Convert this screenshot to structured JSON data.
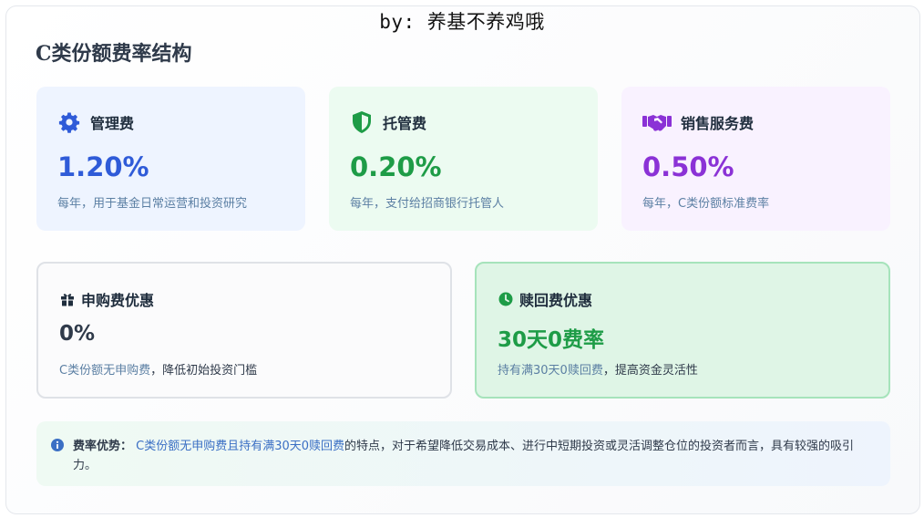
{
  "watermark": "by: 养基不养鸡哦",
  "page_title": "C类份额费率结构",
  "fee_cards": [
    {
      "icon": "gear-icon",
      "name": "管理费",
      "value": "1.20%",
      "desc": "每年，用于基金日常运营和投资研究",
      "color": "#2f5bd8"
    },
    {
      "icon": "shield-icon",
      "name": "托管费",
      "value": "0.20%",
      "desc": "每年，支付给招商银行托管人",
      "color": "#1e9c47"
    },
    {
      "icon": "handshake-icon",
      "name": "销售服务费",
      "value": "0.50%",
      "desc": "每年，C类份额标准费率",
      "color": "#8b32d6"
    }
  ],
  "discount_cards": [
    {
      "icon": "gift-icon",
      "name": "申购费优惠",
      "value": "0%",
      "desc_highlight": "C类份额无申购费",
      "desc_rest": "，降低初始投资门槛"
    },
    {
      "icon": "clock-icon",
      "name": "赎回费优惠",
      "value": "30天0费率",
      "desc_highlight": "持有满30天0赎回费",
      "desc_rest": "，提高资金灵活性"
    }
  ],
  "note": {
    "icon": "info-icon",
    "label": "费率优势：",
    "highlight": "C类份额无申购费且持有满30天0赎回费",
    "rest": "的特点，对于希望降低交易成本、进行中短期投资或灵活调整仓位的投资者而言，具有较强的吸引力。"
  }
}
